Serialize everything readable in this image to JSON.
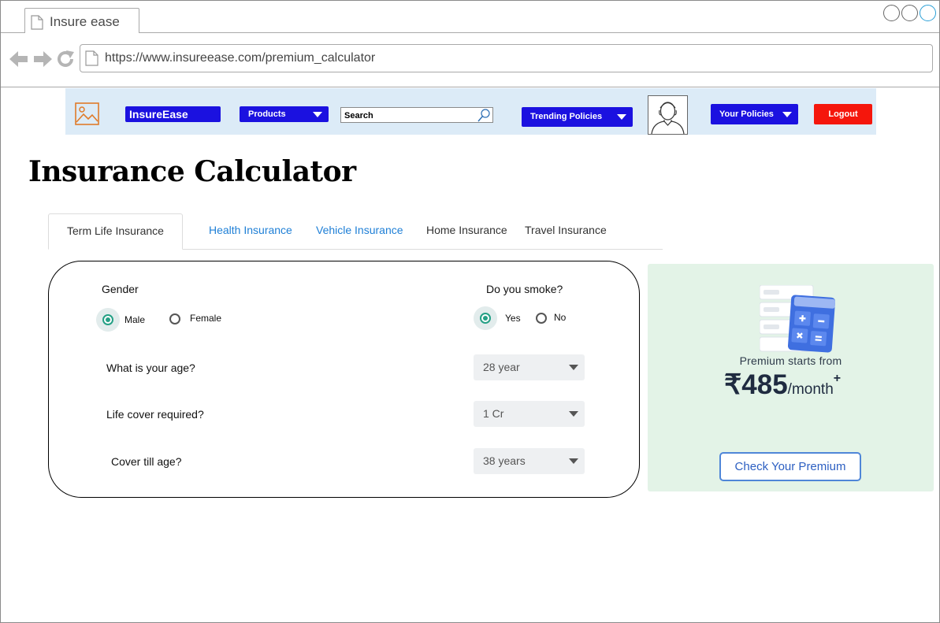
{
  "browser": {
    "tab_title": "Insure ease",
    "url": "https://www.insureease.com/premium_calculator"
  },
  "header": {
    "brand": "InsureEase",
    "products_label": "Products",
    "search_placeholder": "Search",
    "trending_label": "Trending Policies",
    "your_policies_label": "Your Policies",
    "logout_label": "Logout"
  },
  "page": {
    "title": "Insurance Calculator"
  },
  "tabs": [
    {
      "label": "Term Life Insurance",
      "active": true
    },
    {
      "label": "Health Insurance",
      "style": "link"
    },
    {
      "label": "Vehicle Insurance",
      "style": "link"
    },
    {
      "label": "Home Insurance",
      "style": "plain"
    },
    {
      "label": "Travel Insurance",
      "style": "plain"
    }
  ],
  "form": {
    "gender": {
      "label": "Gender",
      "options": [
        "Male",
        "Female"
      ],
      "selected": "Male"
    },
    "smoke": {
      "label": "Do you smoke?",
      "options": [
        "Yes",
        "No"
      ],
      "selected": "Yes"
    },
    "age": {
      "label": "What is your age?",
      "value": "28 year"
    },
    "cover": {
      "label": "Life cover required?",
      "value": "1 Cr"
    },
    "cover_till": {
      "label": "Cover till age?",
      "value": "38 years"
    }
  },
  "premium": {
    "label": "Premium starts from",
    "amount": "₹485",
    "suffix": "/month",
    "sup": "+",
    "cta": "Check Your Premium"
  },
  "colors": {
    "brand_blue": "#1b11e0",
    "logout_red": "#f5160c",
    "radio_green": "#24a085",
    "tab_link": "#1e7fd6",
    "header_bg": "#dcebf7",
    "premium_bg": "#e3f3e7"
  },
  "icons": [
    "page-icon",
    "back-arrow-icon",
    "forward-arrow-icon",
    "reload-icon",
    "image-icon",
    "search-icon",
    "user-avatar-icon",
    "calculator-icon"
  ]
}
